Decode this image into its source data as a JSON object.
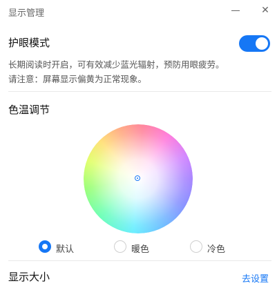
{
  "window": {
    "title": "显示管理",
    "minimize_glyph": "—",
    "close_glyph": "✕"
  },
  "eye_protection": {
    "title": "护眼模式",
    "enabled": true,
    "desc_line1": "长期阅读时开启，可有效减少蓝光辐射，预防用眼疲劳。",
    "desc_line2": "请注意：屏幕显示偏黄为正常现象。"
  },
  "color_temp": {
    "title": "色温调节",
    "options": [
      {
        "label": "默认",
        "checked": true
      },
      {
        "label": "暖色",
        "checked": false
      },
      {
        "label": "冷色",
        "checked": false
      }
    ]
  },
  "display_size": {
    "title": "显示大小",
    "link": "去设置"
  },
  "colors": {
    "accent": "#1677f5"
  }
}
